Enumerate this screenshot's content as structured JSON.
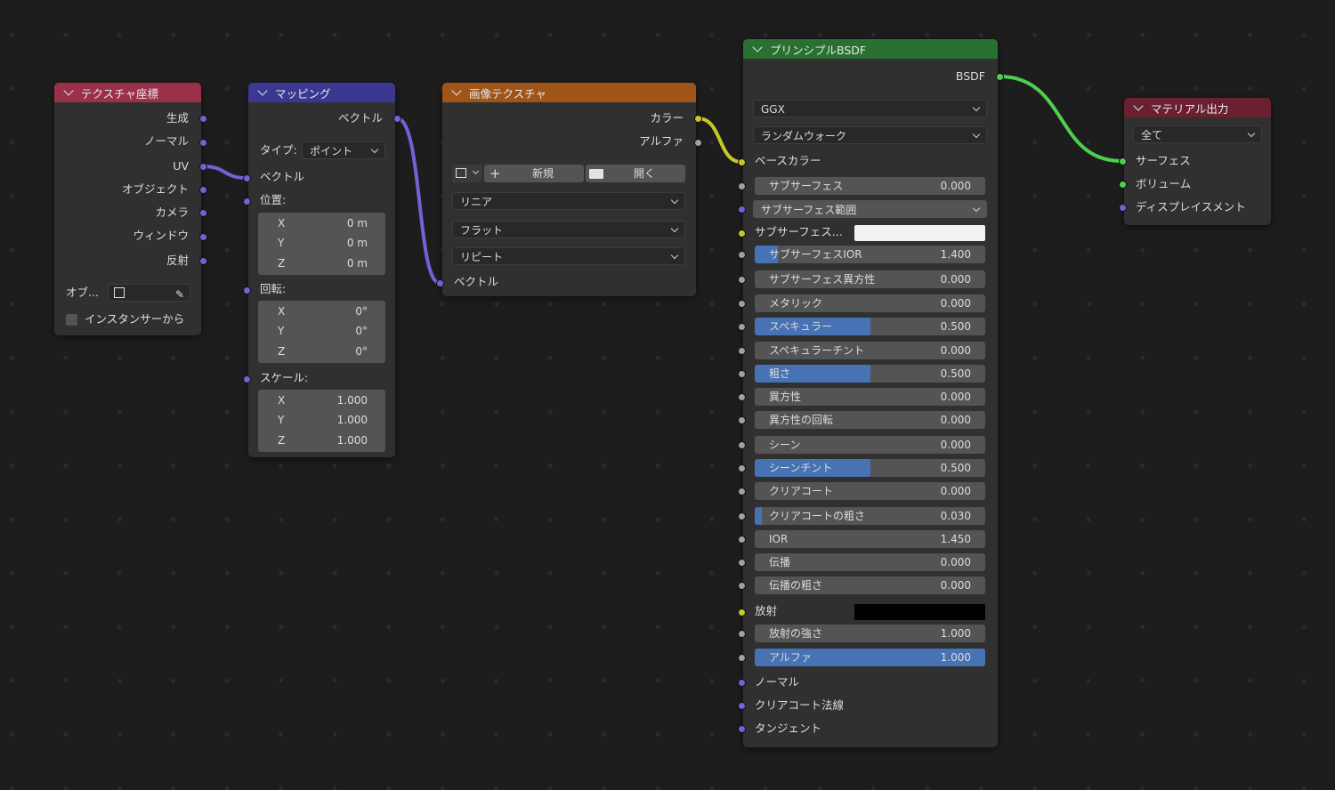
{
  "colors": {
    "background": "#1d1d1d",
    "node_body": "#303030",
    "header_texcoord": "#9a3049",
    "header_mapping": "#3b3792",
    "header_image": "#a05518",
    "header_bsdf": "#2a7030",
    "header_output": "#6a2030",
    "socket_vector": "#6e64d6",
    "socket_color": "#c7c729",
    "socket_float": "#a1a1a1",
    "socket_shader": "#4fcf50",
    "slider_fill": "#4772b3"
  },
  "texcoord": {
    "title": "テクスチャ座標",
    "outputs": [
      "生成",
      "ノーマル",
      "UV",
      "オブジェクト",
      "カメラ",
      "ウィンドウ",
      "反射"
    ],
    "object_label": "オブ...",
    "instancer_label": "インスタンサーから"
  },
  "mapping": {
    "title": "マッピング",
    "output_label": "ベクトル",
    "type_label": "タイプ:",
    "type_value": "ポイント",
    "vector_label": "ベクトル",
    "location_label": "位置:",
    "location": [
      {
        "axis": "X",
        "value": "0 m"
      },
      {
        "axis": "Y",
        "value": "0 m"
      },
      {
        "axis": "Z",
        "value": "0 m"
      }
    ],
    "rotation_label": "回転:",
    "rotation": [
      {
        "axis": "X",
        "value": "0°"
      },
      {
        "axis": "Y",
        "value": "0°"
      },
      {
        "axis": "Z",
        "value": "0°"
      }
    ],
    "scale_label": "スケール:",
    "scale": [
      {
        "axis": "X",
        "value": "1.000"
      },
      {
        "axis": "Y",
        "value": "1.000"
      },
      {
        "axis": "Z",
        "value": "1.000"
      }
    ]
  },
  "image": {
    "title": "画像テクスチャ",
    "color_out": "カラー",
    "alpha_out": "アルファ",
    "new_label": "新規",
    "open_label": "開く",
    "interpolation": "リニア",
    "projection": "フラット",
    "extension": "リピート",
    "vector_label": "ベクトル"
  },
  "bsdf": {
    "title": "プリンシプルBSDF",
    "output_label": "BSDF",
    "distribution": "GGX",
    "subsurface_method": "ランダムウォーク",
    "base_color_label": "ベースカラー",
    "subsurface_radius_label": "サブサーフェス範囲",
    "subsurface_color_label": "サブサーフェス...",
    "emission_label": "放射",
    "normal_label": "ノーマル",
    "clearcoat_normal_label": "クリアコート法線",
    "tangent_label": "タンジェント",
    "sliders": [
      {
        "label": "サブサーフェス",
        "value": "0.000",
        "fill": 0
      },
      {
        "label": "サブサーフェスIOR",
        "value": "1.400",
        "fill": 0.1
      },
      {
        "label": "サブサーフェス異方性",
        "value": "0.000",
        "fill": 0
      },
      {
        "label": "メタリック",
        "value": "0.000",
        "fill": 0
      },
      {
        "label": "スペキュラー",
        "value": "0.500",
        "fill": 0.5
      },
      {
        "label": "スペキュラーチント",
        "value": "0.000",
        "fill": 0
      },
      {
        "label": "粗さ",
        "value": "0.500",
        "fill": 0.5
      },
      {
        "label": "異方性",
        "value": "0.000",
        "fill": 0
      },
      {
        "label": "異方性の回転",
        "value": "0.000",
        "fill": 0
      },
      {
        "label": "シーン",
        "value": "0.000",
        "fill": 0
      },
      {
        "label": "シーンチント",
        "value": "0.500",
        "fill": 0.5
      },
      {
        "label": "クリアコート",
        "value": "0.000",
        "fill": 0
      },
      {
        "label": "クリアコートの粗さ",
        "value": "0.030",
        "fill": 0.03
      },
      {
        "label": "IOR",
        "value": "1.450",
        "fill": 0
      },
      {
        "label": "伝播",
        "value": "0.000",
        "fill": 0
      },
      {
        "label": "伝播の粗さ",
        "value": "0.000",
        "fill": 0
      },
      {
        "label": "放射の強さ",
        "value": "1.000",
        "fill": 0
      },
      {
        "label": "アルファ",
        "value": "1.000",
        "fill": 1
      }
    ]
  },
  "output": {
    "title": "マテリアル出力",
    "target": "全て",
    "inputs": [
      "サーフェス",
      "ボリューム",
      "ディスプレイスメント"
    ]
  }
}
